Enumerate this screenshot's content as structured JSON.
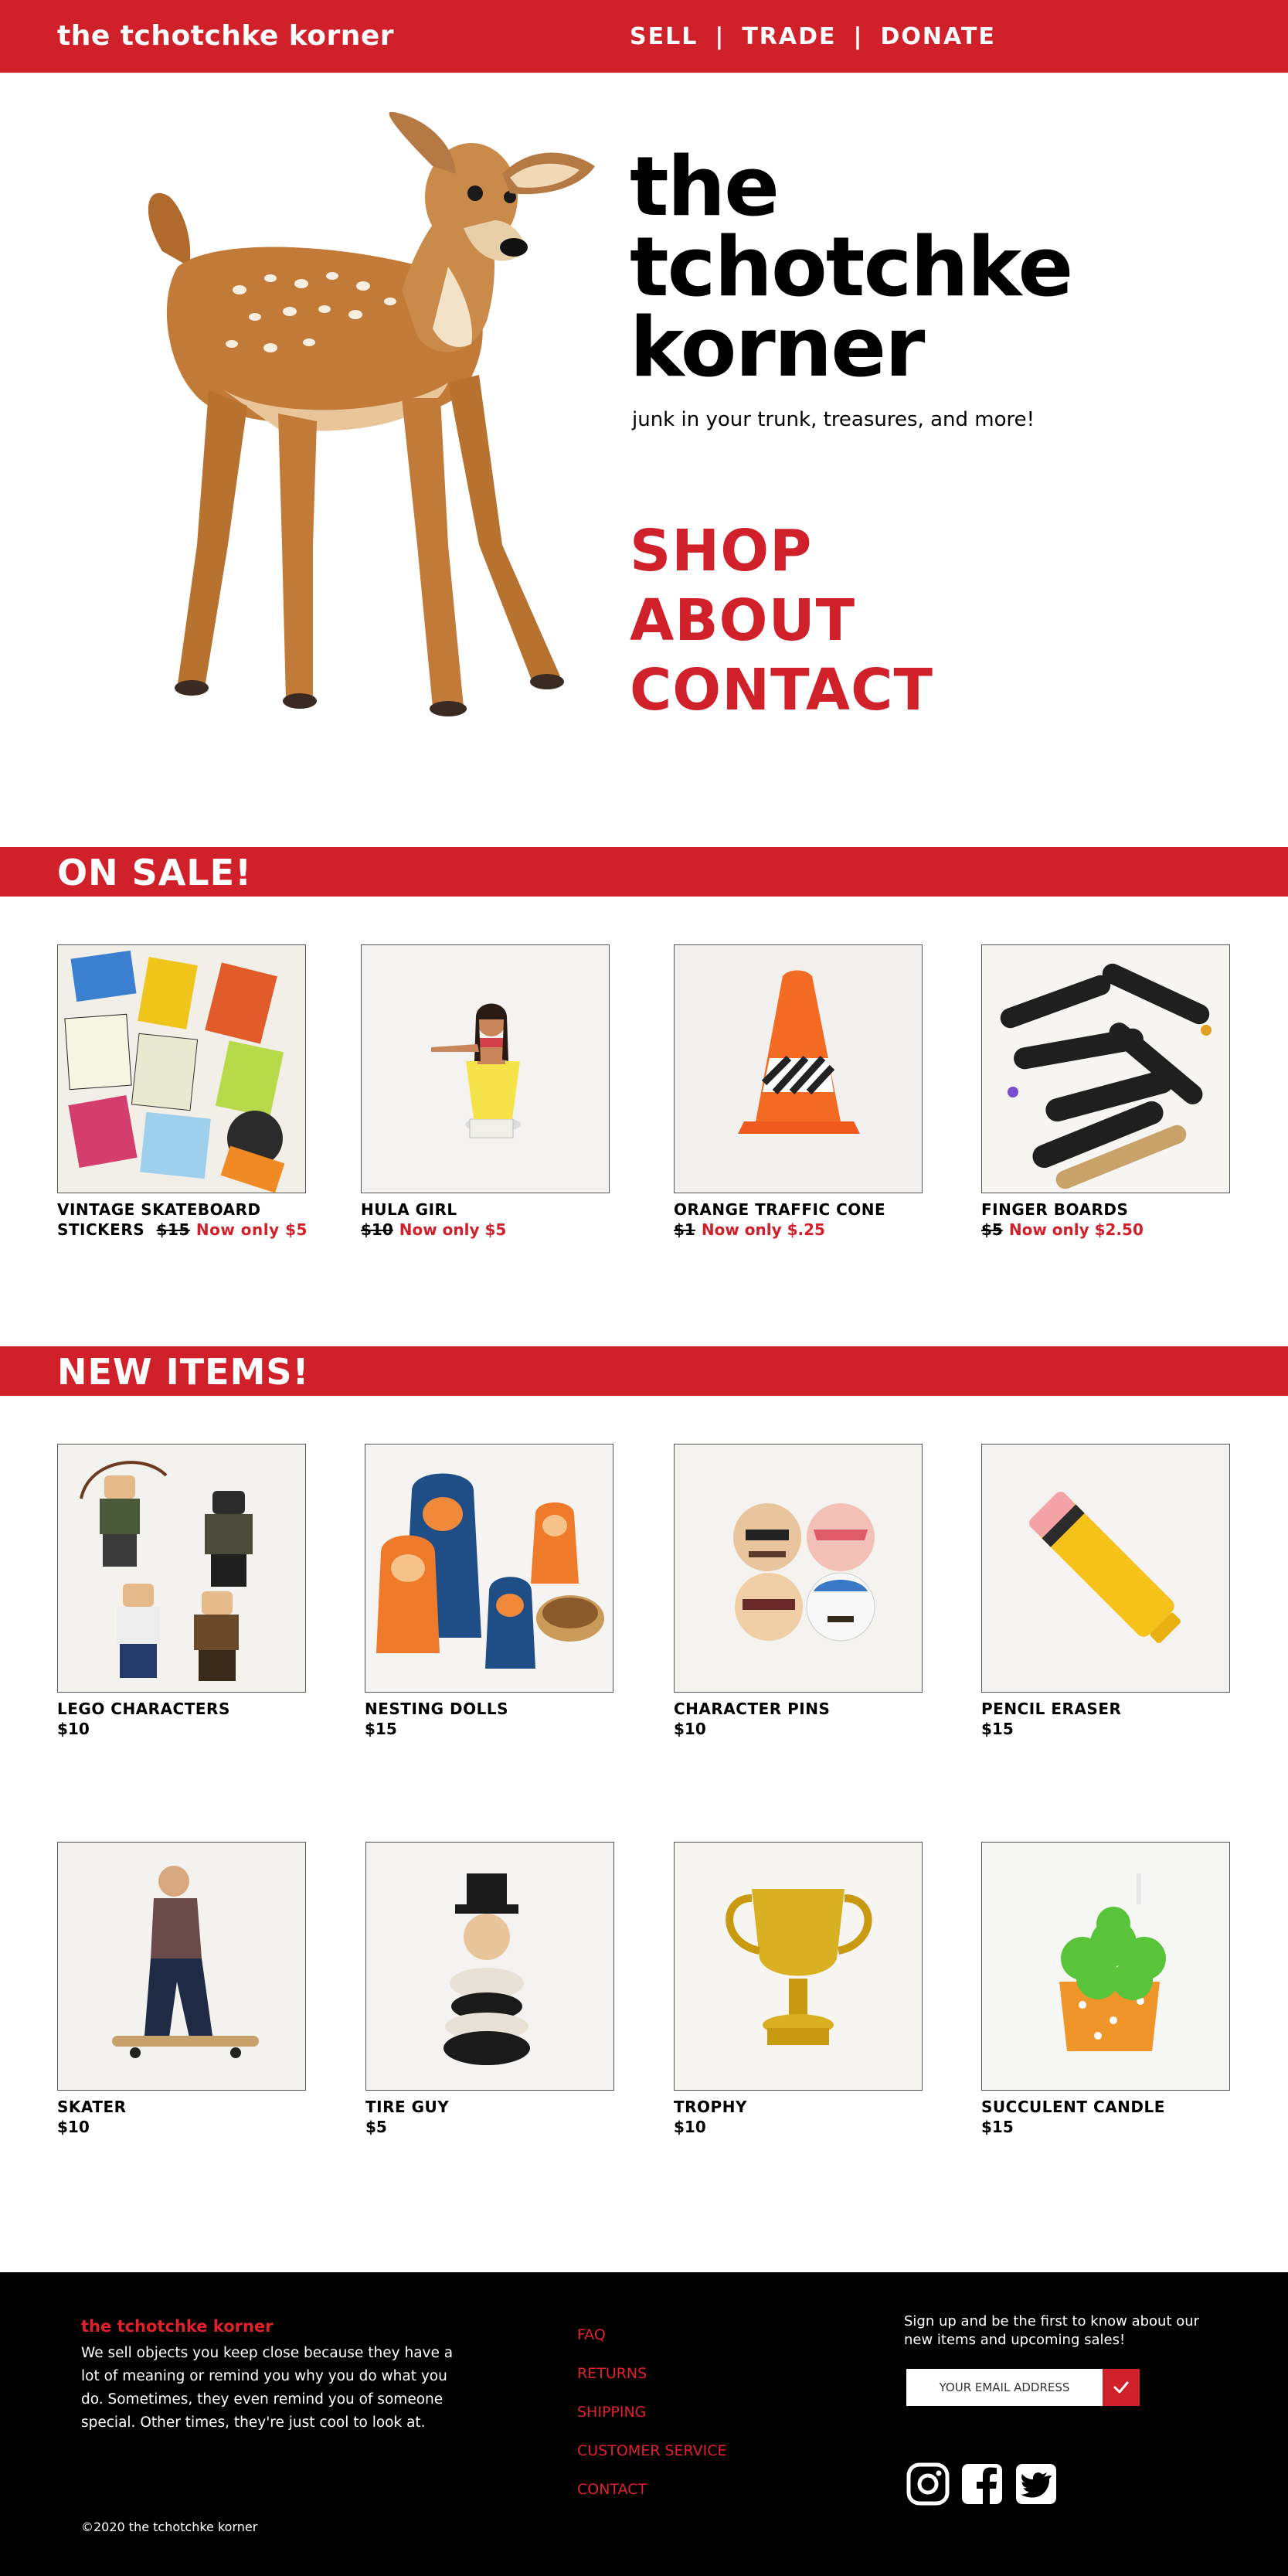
{
  "header": {
    "brand": "the tchotchke korner",
    "nav": [
      "SELL",
      "TRADE",
      "DONATE"
    ],
    "separator": "|"
  },
  "hero": {
    "title_lines": [
      "the",
      "tchotchke",
      "korner"
    ],
    "tagline": "junk in your trunk, treasures, and more!",
    "links": [
      "SHOP",
      "ABOUT",
      "CONTACT"
    ]
  },
  "sale": {
    "heading": "ON SALE!",
    "items": [
      {
        "name_line1": "VINTAGE SKATEBOARD",
        "name_line2": "STICKERS",
        "old_price": "$15",
        "sale_price": "Now only $5"
      },
      {
        "name": "HULA GIRL",
        "old_price": "$10",
        "sale_price": "Now only $5"
      },
      {
        "name": "ORANGE TRAFFIC CONE",
        "old_price": "$1",
        "sale_price": "Now only $.25"
      },
      {
        "name": "FINGER BOARDS",
        "old_price": "$5",
        "sale_price": "Now only $2.50"
      }
    ]
  },
  "new_items": {
    "heading": "NEW ITEMS!",
    "items": [
      {
        "name": "LEGO CHARACTERS",
        "price": "$10"
      },
      {
        "name": "NESTING DOLLS",
        "price": "$15"
      },
      {
        "name": "CHARACTER PINS",
        "price": "$10"
      },
      {
        "name": "PENCIL ERASER",
        "price": "$15"
      },
      {
        "name": "SKATER",
        "price": "$10"
      },
      {
        "name": "TIRE GUY",
        "price": "$5"
      },
      {
        "name": "TROPHY",
        "price": "$10"
      },
      {
        "name": "SUCCULENT CANDLE",
        "price": "$15"
      }
    ]
  },
  "footer": {
    "brand": "the tchotchke korner",
    "description": "We sell objects you keep close because they have a lot of meaning or remind you why you do what you do. Sometimes, they even remind you of someone special. Other times, they're just cool to look at.",
    "copyright": "©2020 the tchotchke korner",
    "links": [
      "FAQ",
      "RETURNS",
      "SHIPPING",
      "CUSTOMER SERVICE",
      "CONTACT"
    ],
    "signup_text": "Sign up and be the first to know about our new items and upcoming sales!",
    "email_placeholder": "YOUR EMAIL ADDRESS",
    "social": [
      "instagram-icon",
      "facebook-icon",
      "twitter-icon"
    ]
  },
  "colors": {
    "brand_red": "#d0202a",
    "footer_bg": "#000000"
  }
}
